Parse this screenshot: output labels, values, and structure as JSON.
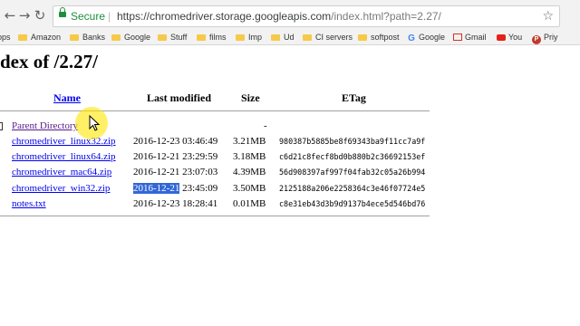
{
  "browser": {
    "secure_label": "Secure",
    "url_host": "https://chromedriver.storage.googleapis.com",
    "url_path": "/index.html?path=2.27/"
  },
  "bookmarks": [
    {
      "label": "ops",
      "icon": "apps-icon"
    },
    {
      "label": "Amazon",
      "icon": "folder-icon"
    },
    {
      "label": "Banks",
      "icon": "folder-icon"
    },
    {
      "label": "Google",
      "icon": "folder-icon"
    },
    {
      "label": "Stuff",
      "icon": "folder-icon"
    },
    {
      "label": "films",
      "icon": "folder-icon"
    },
    {
      "label": "Imp",
      "icon": "folder-icon"
    },
    {
      "label": "Ud",
      "icon": "folder-icon"
    },
    {
      "label": "CI servers",
      "icon": "folder-icon"
    },
    {
      "label": "softpost",
      "icon": "folder-icon"
    },
    {
      "label": "Google",
      "icon": "google-icon"
    },
    {
      "label": "Gmail",
      "icon": "gmail-icon"
    },
    {
      "label": "You",
      "icon": "youtube-icon"
    },
    {
      "label": "Priy",
      "icon": "pinterest-icon"
    }
  ],
  "page": {
    "title": "dex of /2.27/",
    "headers": {
      "name": "Name",
      "last_modified": "Last modified",
      "size": "Size",
      "etag": "ETag"
    },
    "parent": {
      "name": "Parent Directory",
      "size": "-"
    },
    "files": [
      {
        "name": "chromedriver_linux32.zip",
        "modified": "2016-12-23 03:46:49",
        "size": "3.21MB",
        "etag": "980387b5885be8f69343ba9f11cc7a9f"
      },
      {
        "name": "chromedriver_linux64.zip",
        "modified": "2016-12-21 23:29:59",
        "size": "3.18MB",
        "etag": "c6d21c8fecf8bd0b880b2c36692153ef"
      },
      {
        "name": "chromedriver_mac64.zip",
        "modified": "2016-12-21 23:07:03",
        "size": "4.39MB",
        "etag": "56d908397af997f04fab32c05a26b994"
      },
      {
        "name": "chromedriver_win32.zip",
        "modified_selected": "2016-12-21",
        "modified_rest": " 23:45:09",
        "size": "3.50MB",
        "etag": "2125188a206e2258364c3e46f07724e5"
      },
      {
        "name": "notes.txt",
        "modified": "2016-12-23 18:28:41",
        "size": "0.01MB",
        "etag": "c8e31eb43d3b9d9137b4ece5d546bd76"
      }
    ]
  },
  "colors": {
    "link": "#0000ee",
    "visited_link": "#551a8b",
    "selection": "#3367d6",
    "secure": "#1e8e3e",
    "cursor_highlight": "#ffe600"
  }
}
